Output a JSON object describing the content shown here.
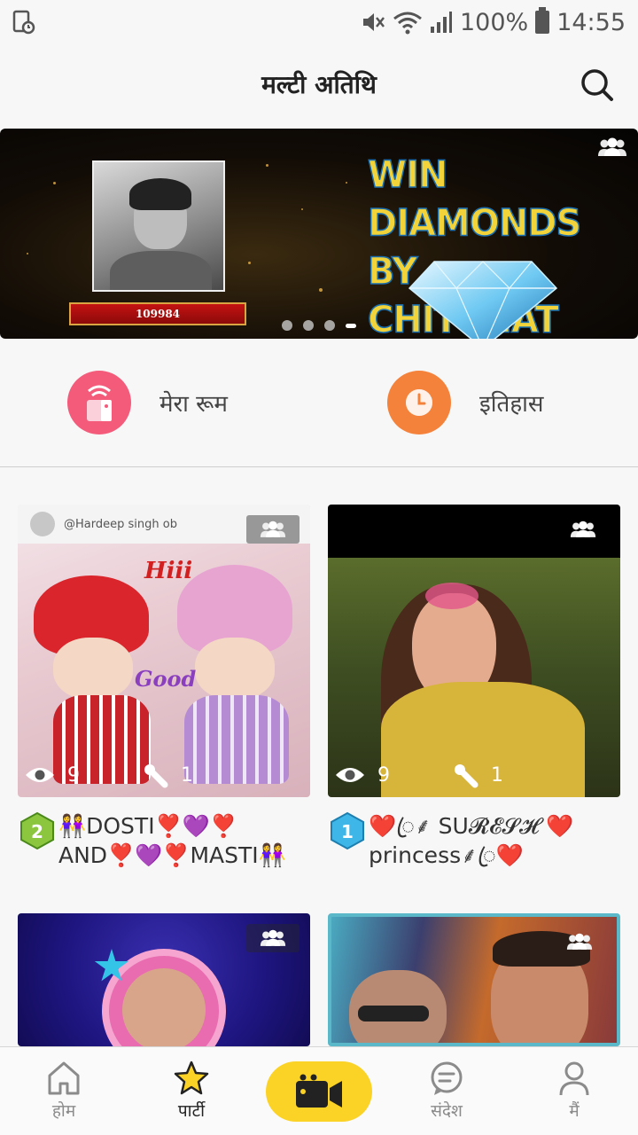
{
  "status_bar": {
    "battery": "100%",
    "time": "14:55"
  },
  "header": {
    "title": "मल्टी अतिथि"
  },
  "banner": {
    "user_id": "109984",
    "headline_1": "WIN DIAMONDS",
    "headline_2": "BY CHITCHAT",
    "page_count": 4,
    "active_page": 4
  },
  "quick_actions": [
    {
      "label": "मेरा रूम",
      "icon": "room-icon"
    },
    {
      "label": "इतिहास",
      "icon": "clock-icon"
    }
  ],
  "rooms": [
    {
      "overlay_text": "@Hardeep singh ob",
      "greeting_1": "Hiii",
      "greeting_2": "Good",
      "views": "9",
      "mics": "1",
      "level": "2",
      "name_line1": "👭DOSTI❣️💜❣️",
      "name_line2": "AND❣️💜❣️MASTI👭"
    },
    {
      "views": "9",
      "mics": "1",
      "level": "1",
      "name_line1": "❤️ꦿ⸙ SU𝓡𝓔𝓢𝓗 ❤️",
      "name_line2": "princess⸙ꦿ❤️"
    },
    {},
    {}
  ],
  "bottom_nav": [
    {
      "label": "होम",
      "icon": "home-icon"
    },
    {
      "label": "पार्टी",
      "icon": "star-icon"
    },
    {
      "label": "",
      "icon": "video-camera-icon"
    },
    {
      "label": "संदेश",
      "icon": "message-icon"
    },
    {
      "label": "मैं",
      "icon": "profile-icon"
    }
  ],
  "colors": {
    "accent_yellow": "#fbd226",
    "room_pink": "#f45b7b",
    "history_orange": "#f5823a"
  }
}
